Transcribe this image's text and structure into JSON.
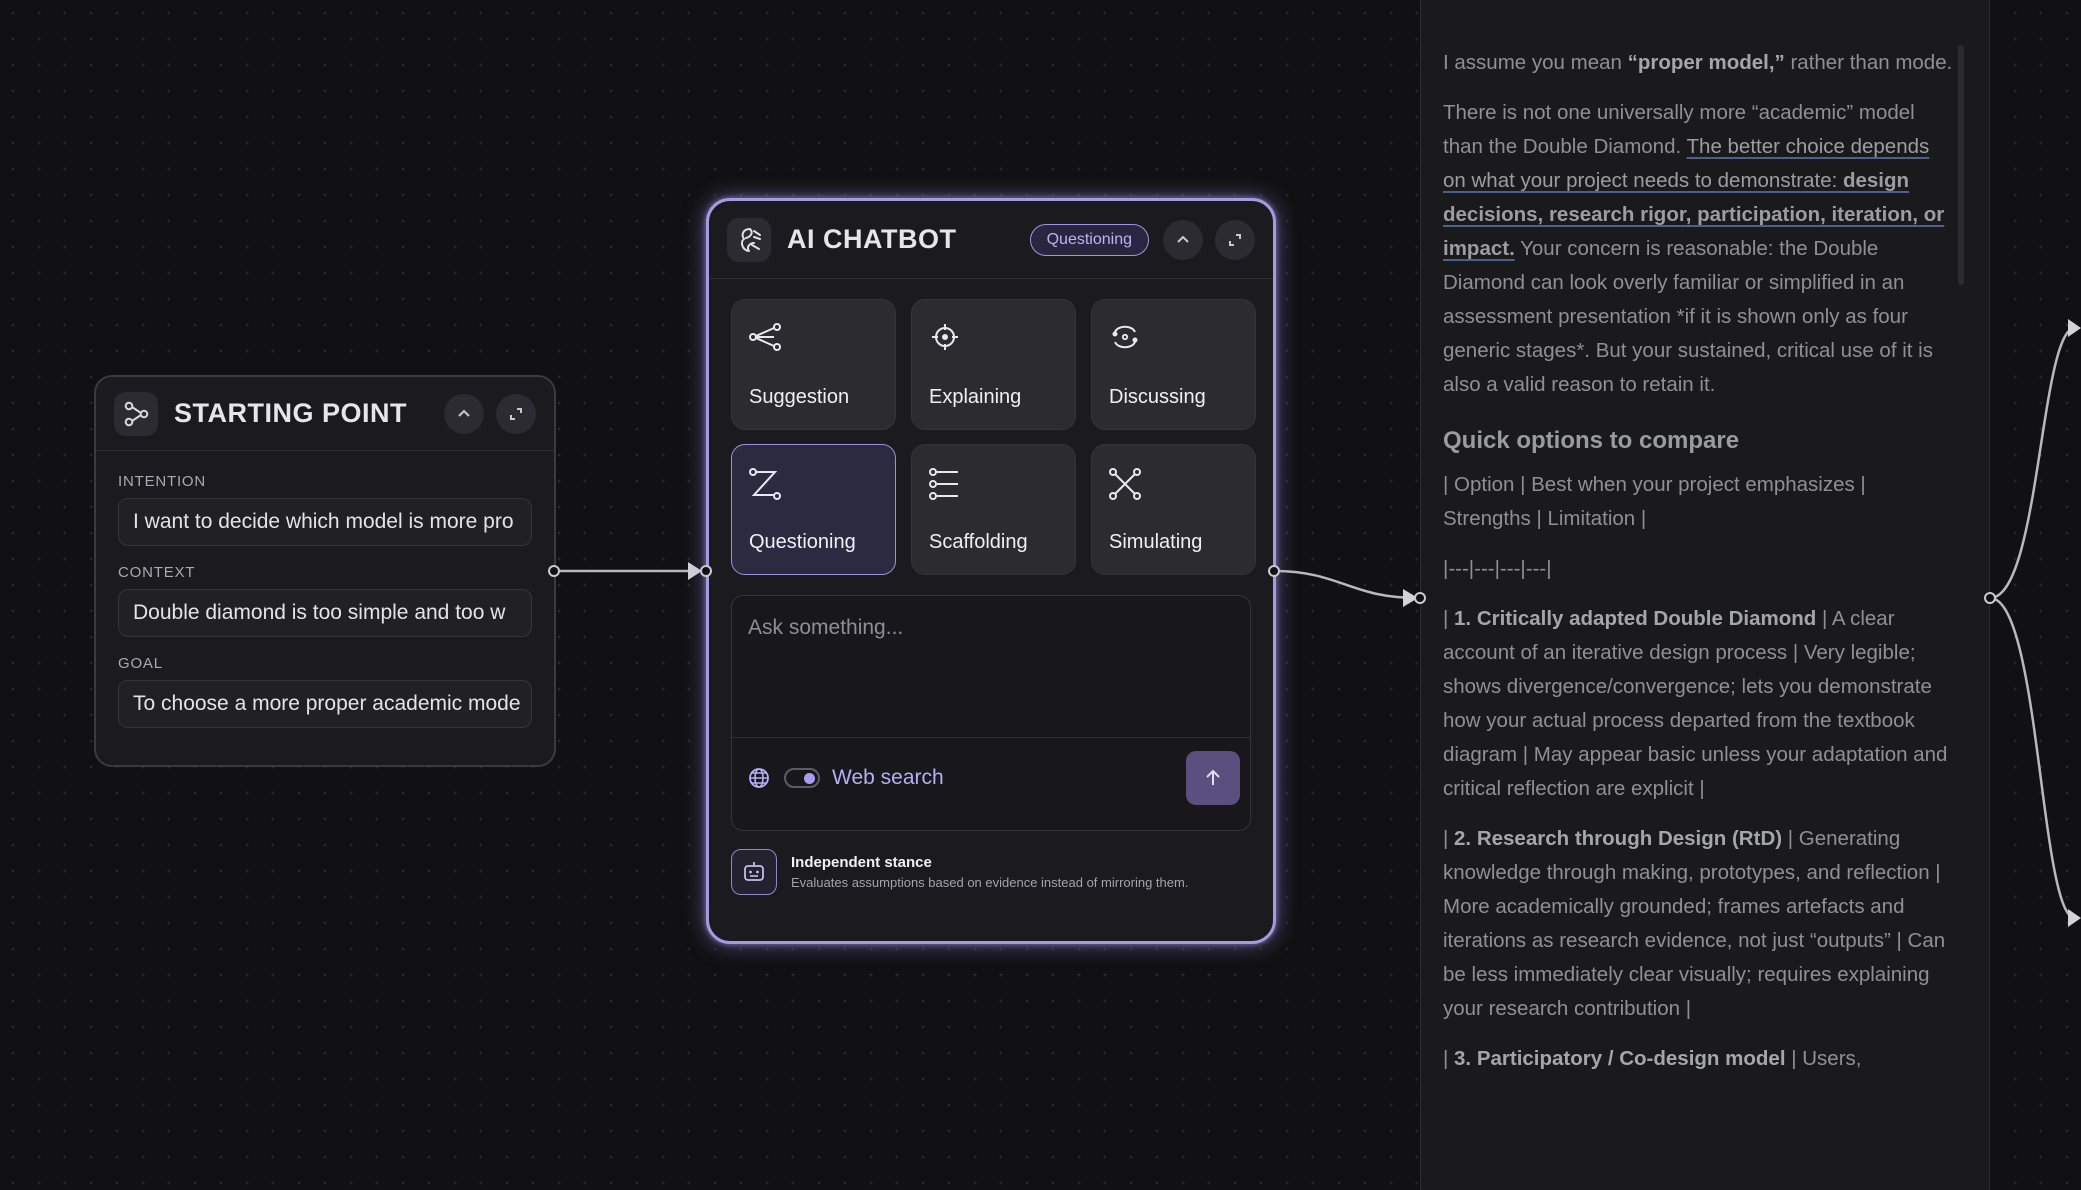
{
  "start_node": {
    "title": "STARTING POINT",
    "fields": [
      {
        "label": "INTENTION",
        "value": "I want to decide which model is more pro"
      },
      {
        "label": "CONTEXT",
        "value": "Double diamond is too simple and too w"
      },
      {
        "label": "GOAL",
        "value": "To choose a more proper academic mode"
      }
    ]
  },
  "chat_node": {
    "title": "AI CHATBOT",
    "mode_badge": "Questioning",
    "tiles": [
      {
        "label": "Suggestion",
        "icon": "share-nodes-icon",
        "active": false
      },
      {
        "label": "Explaining",
        "icon": "crosshair-icon",
        "active": false
      },
      {
        "label": "Discussing",
        "icon": "refresh-cycle-icon",
        "active": false
      },
      {
        "label": "Questioning",
        "icon": "zigzag-path-icon",
        "active": true
      },
      {
        "label": "Scaffolding",
        "icon": "list-nodes-icon",
        "active": false
      },
      {
        "label": "Simulating",
        "icon": "cross-nodes-icon",
        "active": false
      }
    ],
    "composer": {
      "placeholder": "Ask something...",
      "web_search_label": "Web search",
      "web_search_enabled": true
    },
    "stance": {
      "title": "Independent stance",
      "description": "Evaluates assumptions based on evidence instead of mirroring them."
    }
  },
  "output": {
    "p1": {
      "a": "I assume you mean ",
      "b": "“proper model,”",
      "c": " rather than mode."
    },
    "p2": {
      "a": "There is not one universally more “academic” model than the Double Diamond. ",
      "hl": "The better choice depends on what your project needs to demonstrate: ",
      "hl_bold": "design decisions, research rigor, participation, iteration, or impact.",
      "c": " Your concern is reasonable: the Double Diamond can look overly familiar or simplified in an assessment presentation *if it is shown only as four generic stages*. But your sustained, critical use of it is also a valid reason to retain it."
    },
    "heading": "Quick options to compare",
    "table_header": "| Option | Best when your project emphasizes | Strengths | Limitation |",
    "table_sep": "|---|---|---|---|",
    "rows": [
      {
        "pre": "| ",
        "title": "1. Critically adapted Double Diamond",
        "text": " | A clear account of an iterative design process | Very legible; shows divergence/convergence; lets you demonstrate how your actual process departed from the textbook diagram | May appear basic unless your adaptation and critical reflection are explicit |"
      },
      {
        "pre": "| ",
        "title": "2. Research through Design (RtD)",
        "text": " | Generating knowledge through making, prototypes, and reflection | More academically grounded; frames artefacts and iterations as research evidence, not just “outputs” | Can be less immediately clear visually; requires explaining your research contribution |"
      },
      {
        "pre": "| ",
        "title": "3. Participatory / Co-design model",
        "text": " | Users,"
      }
    ]
  },
  "colors": {
    "accent": "#a49bdf",
    "background": "#111113",
    "node": "#1b1b1f"
  }
}
